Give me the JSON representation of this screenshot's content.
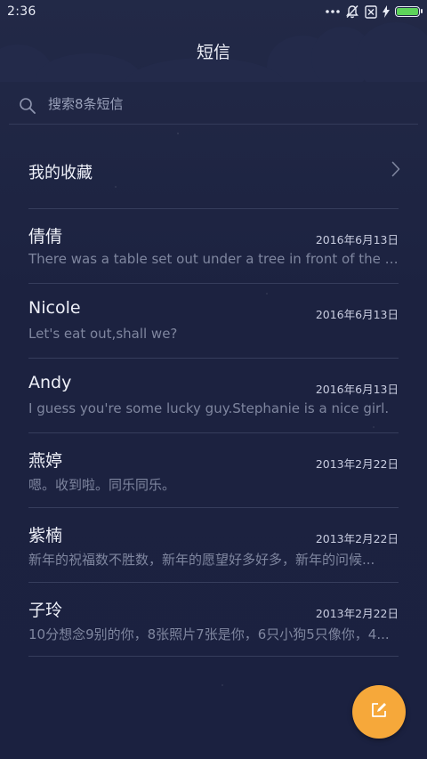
{
  "status_bar": {
    "time": "2:36",
    "battery_level": 1.0,
    "battery_color": "#5dd35a"
  },
  "header": {
    "title": "短信"
  },
  "search": {
    "placeholder": "搜索8条短信"
  },
  "favorites": {
    "label": "我的收藏"
  },
  "messages": [
    {
      "sender": "倩倩",
      "date": "2016年6月13日",
      "preview": "There was a table set out under a tree in front of the ho..."
    },
    {
      "sender": "Nicole",
      "date": "2016年6月13日",
      "preview": "Let's eat out,shall we?"
    },
    {
      "sender": "Andy",
      "date": "2016年6月13日",
      "preview": "I guess you're some lucky guy.Stephanie is a nice girl."
    },
    {
      "sender": "燕婷",
      "date": "2013年2月22日",
      "preview": "嗯。收到啦。同乐同乐。"
    },
    {
      "sender": "紫楠",
      "date": "2013年2月22日",
      "preview": "新年的祝福数不胜数，新年的愿望好多好多，新年的问候..."
    },
    {
      "sender": "子玲",
      "date": "2013年2月22日",
      "preview": "10分想念9别的你，8张照片7张是你，6只小狗5只像你，4..."
    }
  ],
  "colors": {
    "background": "#1c2240",
    "fab": "#f6a83a"
  },
  "icons": {
    "status": [
      "more-dots-icon",
      "mute-bell-icon",
      "sim-error-icon",
      "charging-bolt-icon",
      "battery-icon"
    ],
    "search": "search-icon",
    "favorites": "chevron-right-icon",
    "fab": "compose-icon"
  }
}
